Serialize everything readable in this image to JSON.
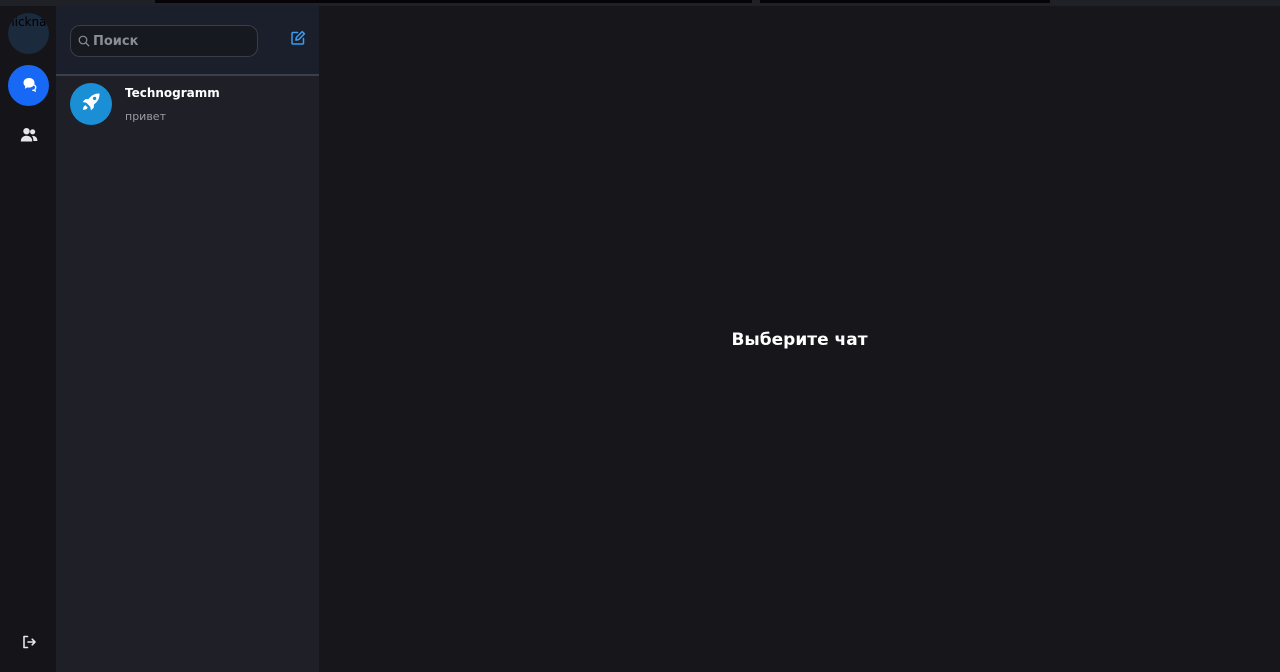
{
  "user": {
    "avatar_label": "nicknam"
  },
  "rail": {
    "chats_icon": "chat-bubbles-icon",
    "contacts_icon": "users-icon",
    "logout_icon": "logout-icon"
  },
  "search": {
    "placeholder": "Поиск",
    "value": ""
  },
  "compose": {
    "icon": "compose-icon"
  },
  "chats": [
    {
      "name": "Technogramm",
      "preview": "привет",
      "avatar_icon": "rocket-icon"
    }
  ],
  "main": {
    "empty_title": "Выберите чат"
  },
  "colors": {
    "accent": "#1769f5",
    "compose_icon": "#3b9cf0",
    "chat_avatar": "#1b8fd6",
    "background": "#16161b",
    "panel": "#1e1f27"
  }
}
